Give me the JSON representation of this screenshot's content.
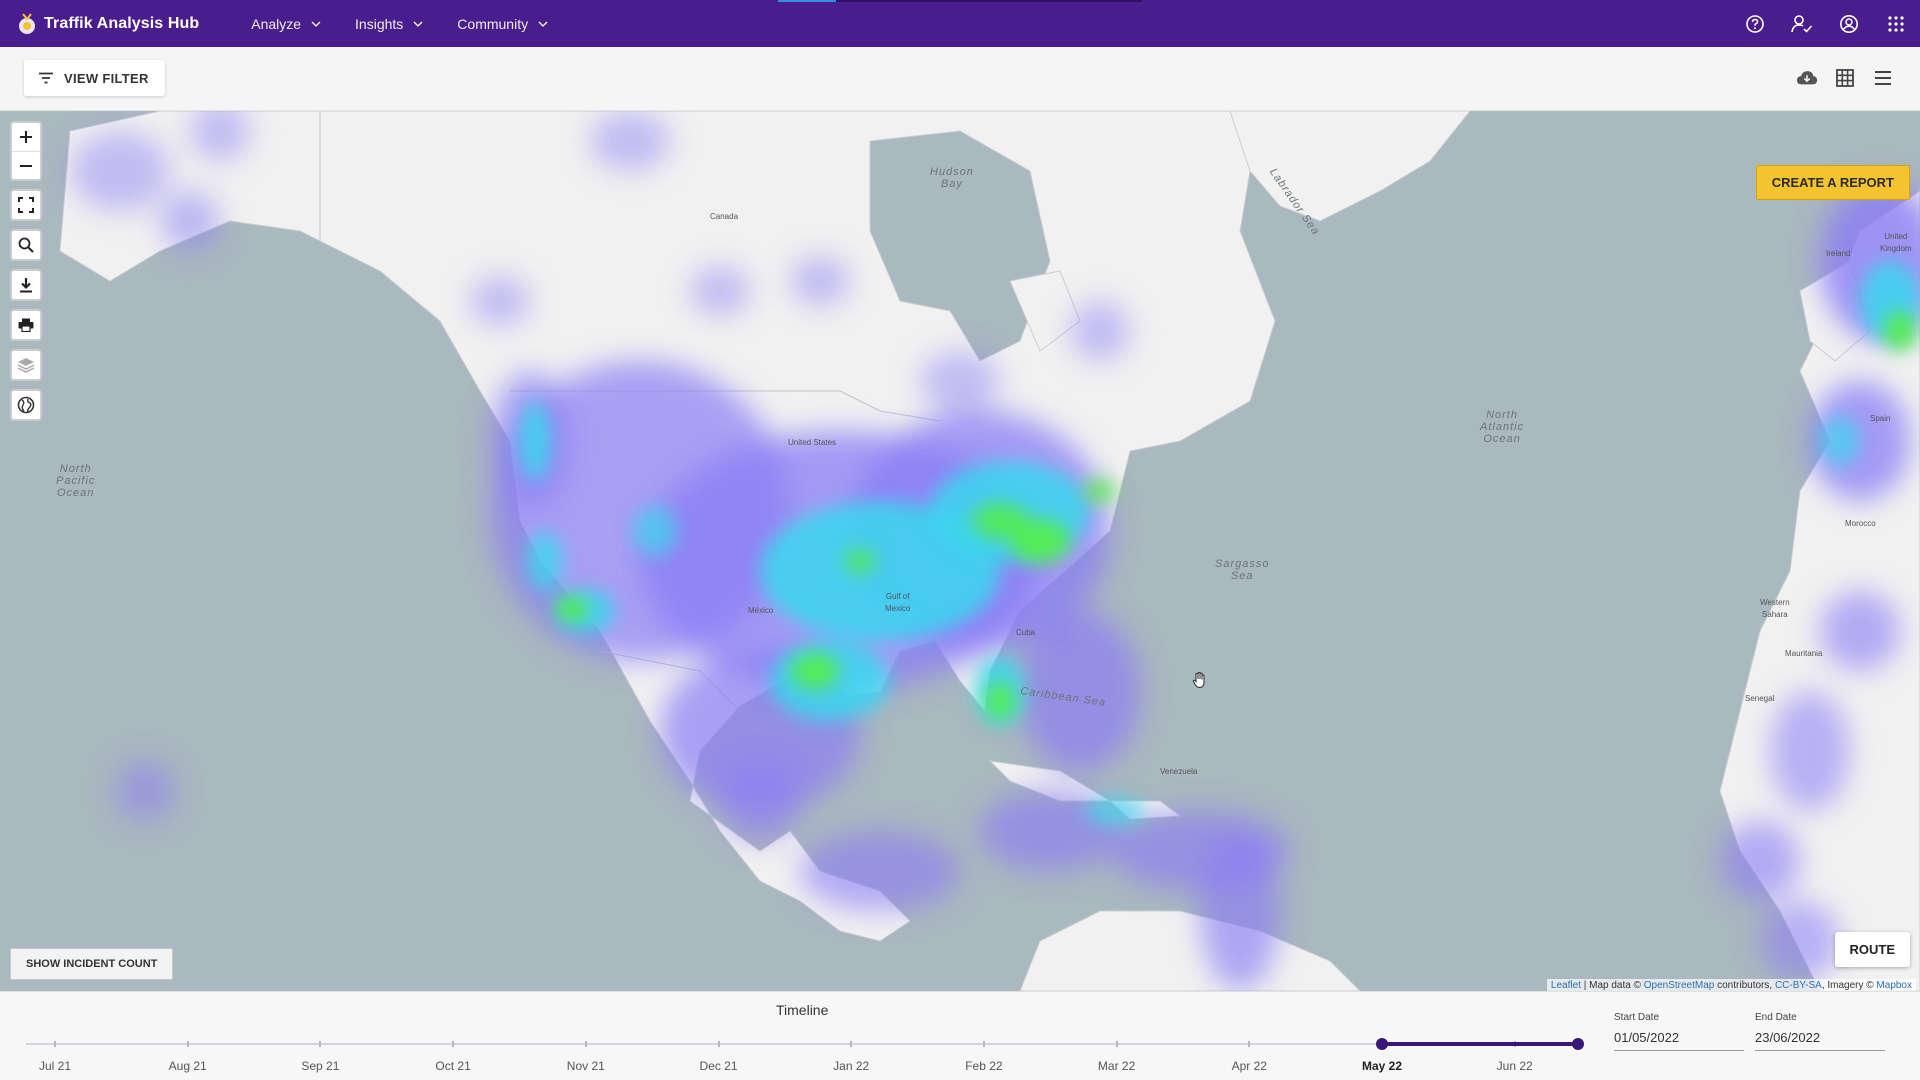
{
  "app": {
    "title": "Traffik Analysis Hub",
    "loading_progress": 0.16
  },
  "nav": {
    "items": [
      {
        "label": "Analyze"
      },
      {
        "label": "Insights"
      },
      {
        "label": "Community"
      }
    ]
  },
  "top_icons": [
    "help-icon",
    "user-follow-icon",
    "account-icon",
    "apps-grid-icon"
  ],
  "filter_bar": {
    "view_filter_label": "VIEW FILTER",
    "tools": [
      "cloud-download-icon",
      "table-grid-icon",
      "list-menu-icon"
    ]
  },
  "map": {
    "controls": [
      "zoom-in",
      "zoom-out",
      "fullscreen",
      "search",
      "download",
      "print",
      "layers",
      "globe"
    ],
    "create_report_label": "CREATE A REPORT",
    "show_incident_count_label": "SHOW INCIDENT COUNT",
    "route_label": "ROUTE",
    "labels": {
      "hudson_bay": "Hudson\nBay",
      "labrador_sea": "Labrador Sea",
      "north_pacific": "North\nPacific\nOcean",
      "north_atlantic": "North\nAtlantic\nOcean",
      "sargasso": "Sargasso\nSea",
      "caribbean": "Caribbean Sea",
      "gulf_mexico": "Gulf of\nMexico",
      "canada": "Canada",
      "united_states": "United States",
      "mexico": "México",
      "cuba": "Cuba",
      "venezuela": "Venezuela",
      "ireland": "Ireland",
      "united_kingdom": "United\nKingdom",
      "spain": "Spain",
      "morocco": "Morocco",
      "mauritania": "Mauritania",
      "senegal": "Senegal",
      "western_sahara": "Western\nSahara"
    },
    "attribution": {
      "leaflet": "Leaflet",
      "sep1": " | Map data © ",
      "osm": "OpenStreetMap",
      "sep2": " contributors, ",
      "license": "CC-BY-SA",
      "sep3": ", Imagery © ",
      "mapbox": "Mapbox"
    }
  },
  "timeline": {
    "title": "Timeline",
    "months": [
      "Jul 21",
      "Aug 21",
      "Sep 21",
      "Oct 21",
      "Nov 21",
      "Dec 21",
      "Jan 22",
      "Feb 22",
      "Mar 22",
      "Apr 22",
      "May 22",
      "Jun 22"
    ],
    "range_start_index": 10,
    "start_date_label": "Start Date",
    "start_date": "01/05/2022",
    "end_date_label": "End Date",
    "end_date": "23/06/2022"
  },
  "colors": {
    "topbar": "#4a1d8f",
    "accent": "#3b1577",
    "report_button": "#f4c430",
    "heat_low": "#7b6cf5",
    "heat_mid": "#33d9f0",
    "heat_high": "#4cf04a"
  }
}
